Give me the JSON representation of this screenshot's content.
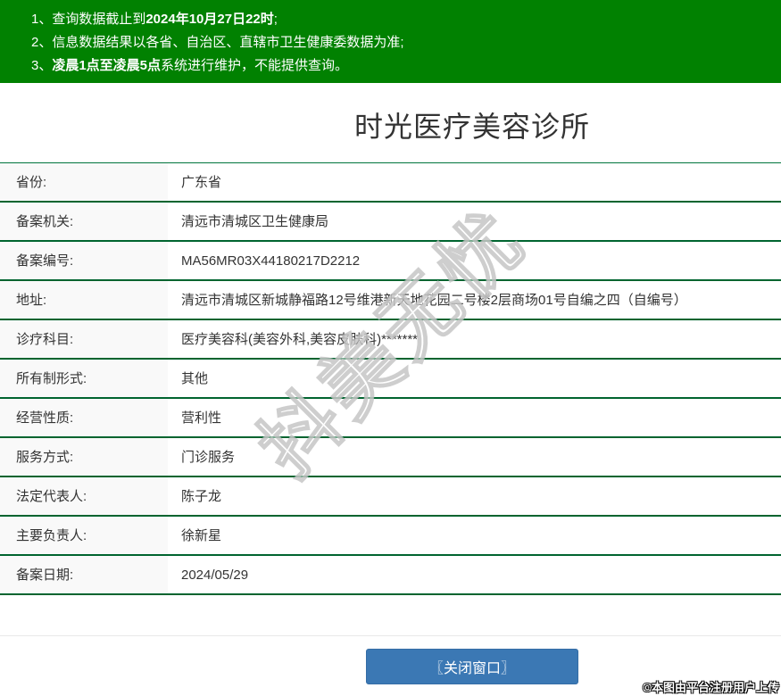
{
  "notices": [
    {
      "pre": "1、查询数据截止到",
      "bold": "2024年10月27日22时",
      "post": ";"
    },
    {
      "pre": "2、信息数据结果以各省、自治区、直辖市卫生健康委数据为准;",
      "bold": "",
      "post": ""
    },
    {
      "pre": "3、",
      "bold": "凌晨1点至凌晨5点",
      "post": "系统进行维护，不能提供查询。"
    }
  ],
  "title": "时光医疗美容诊所",
  "table": {
    "rows": [
      {
        "label": "省份:",
        "value": "广东省"
      },
      {
        "label": "备案机关:",
        "value": "清远市清城区卫生健康局"
      },
      {
        "label": "备案编号:",
        "value": "MA56MR03X44180217D2212"
      },
      {
        "label": "地址:",
        "value": "清远市清城区新城静福路12号维港新天地花园二号楼2层商场01号自编之四（自编号）"
      },
      {
        "label": "诊疗科目:",
        "value": "医疗美容科(美容外科,美容皮肤科)*******"
      },
      {
        "label": "所有制形式:",
        "value": "其他"
      },
      {
        "label": "经营性质:",
        "value": "营利性"
      },
      {
        "label": "服务方式:",
        "value": "门诊服务"
      },
      {
        "label": "法定代表人:",
        "value": "陈子龙"
      },
      {
        "label": "主要负责人:",
        "value": "徐新星"
      },
      {
        "label": "备案日期:",
        "value": "2024/05/29"
      }
    ]
  },
  "footer": {
    "close_label": "〖关闭窗口〗"
  },
  "watermarks": {
    "center": "抖美无忧",
    "corner": "©本图由平台注册用户上传"
  },
  "colors": {
    "banner_green": "#018101",
    "divider_green": "#00642f",
    "button_blue": "#3b78b4",
    "label_bg": "#f9f9f9"
  }
}
